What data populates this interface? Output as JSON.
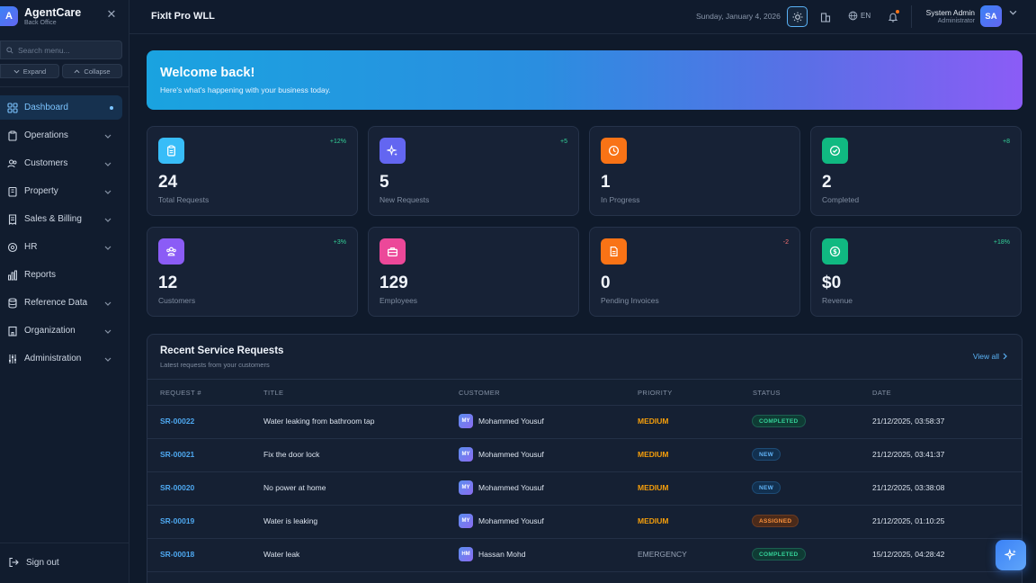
{
  "brand": {
    "logo_letter": "A",
    "name": "AgentCare",
    "subtitle": "Back Office"
  },
  "sidebar": {
    "search_placeholder": "Search menu...",
    "expand_label": "Expand",
    "collapse_label": "Collapse",
    "items": [
      {
        "label": "Dashboard",
        "icon": "grid-icon",
        "active": true
      },
      {
        "label": "Operations",
        "icon": "clipboard-icon"
      },
      {
        "label": "Customers",
        "icon": "users-icon"
      },
      {
        "label": "Property",
        "icon": "building-icon"
      },
      {
        "label": "Sales & Billing",
        "icon": "receipt-icon"
      },
      {
        "label": "HR",
        "icon": "circle-user-icon"
      },
      {
        "label": "Reports",
        "icon": "bar-chart-icon"
      },
      {
        "label": "Reference Data",
        "icon": "database-icon"
      },
      {
        "label": "Organization",
        "icon": "office-icon"
      },
      {
        "label": "Administration",
        "icon": "sliders-icon"
      }
    ],
    "signout_label": "Sign out"
  },
  "header": {
    "company": "FixIt Pro WLL",
    "date": "Sunday, January 4, 2026",
    "language": "EN",
    "user_name": "System Admin",
    "user_role": "Administrator",
    "user_initials": "SA"
  },
  "welcome": {
    "title": "Welcome back!",
    "subtitle": "Here's what's happening with your business today."
  },
  "stats": [
    {
      "value": "24",
      "label": "Total Requests",
      "delta": "+12%",
      "color": "#38bdf8",
      "icon": "clipboard-icon"
    },
    {
      "value": "5",
      "label": "New Requests",
      "delta": "+5",
      "color": "#6366f1",
      "icon": "sparkles-icon"
    },
    {
      "value": "1",
      "label": "In Progress",
      "delta": "",
      "color": "#f97316",
      "icon": "clock-icon"
    },
    {
      "value": "2",
      "label": "Completed",
      "delta": "+8",
      "color": "#10b981",
      "icon": "check-circle-icon"
    },
    {
      "value": "12",
      "label": "Customers",
      "delta": "+3%",
      "color": "#8b5cf6",
      "icon": "users-icon"
    },
    {
      "value": "129",
      "label": "Employees",
      "delta": "",
      "color": "#ec4899",
      "icon": "briefcase-icon"
    },
    {
      "value": "0",
      "label": "Pending Invoices",
      "delta": "-2",
      "color": "#f97316",
      "icon": "document-icon"
    },
    {
      "value": "$0",
      "label": "Revenue",
      "delta": "+18%",
      "color": "#10b981",
      "icon": "dollar-icon"
    }
  ],
  "requests": {
    "title": "Recent Service Requests",
    "subtitle": "Latest requests from your customers",
    "view_all": "View all",
    "columns": [
      "REQUEST #",
      "TITLE",
      "CUSTOMER",
      "PRIORITY",
      "STATUS",
      "DATE"
    ],
    "rows": [
      {
        "id": "SR-00022",
        "title": "Water leaking from bathroom tap",
        "initials": "MY",
        "customer": "Mohammed Yousuf",
        "priority": "MEDIUM",
        "status": "COMPLETED",
        "date": "21/12/2025, 03:58:37"
      },
      {
        "id": "SR-00021",
        "title": "Fix the door lock",
        "initials": "MY",
        "customer": "Mohammed Yousuf",
        "priority": "MEDIUM",
        "status": "NEW",
        "date": "21/12/2025, 03:41:37"
      },
      {
        "id": "SR-00020",
        "title": "No power at home",
        "initials": "MY",
        "customer": "Mohammed Yousuf",
        "priority": "MEDIUM",
        "status": "NEW",
        "date": "21/12/2025, 03:38:08"
      },
      {
        "id": "SR-00019",
        "title": "Water is leaking",
        "initials": "MY",
        "customer": "Mohammed Yousuf",
        "priority": "MEDIUM",
        "status": "ASSIGNED",
        "date": "21/12/2025, 01:10:25"
      },
      {
        "id": "SR-00018",
        "title": "Water leak",
        "initials": "HM",
        "customer": "Hassan Mohd",
        "priority": "EMERGENCY",
        "status": "COMPLETED",
        "date": "15/12/2025, 04:28:42"
      }
    ]
  }
}
